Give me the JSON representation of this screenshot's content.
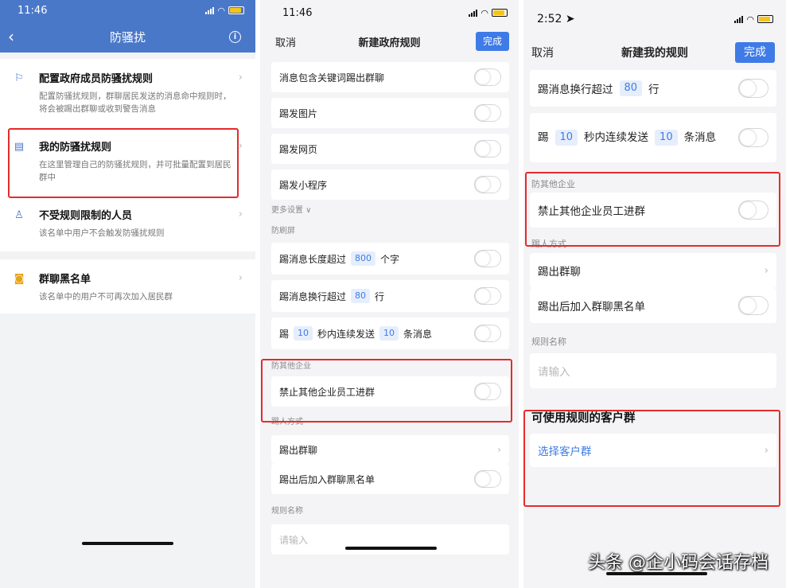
{
  "panel1": {
    "status_time": "11:46",
    "title": "防骚扰",
    "items": [
      {
        "title": "配置政府成员防骚扰规则",
        "desc": "配置防骚扰规则，群聊居民发送的消息命中规则时，将会被踢出群聊或收到警告消息"
      },
      {
        "title": "我的防骚扰规则",
        "desc": "在这里管理自己的防骚扰规则，并可批量配置到居民群中"
      },
      {
        "title": "不受规则限制的人员",
        "desc": "该名单中用户不会触发防骚扰规则"
      },
      {
        "title": "群聊黑名单",
        "desc": "该名单中的用户不可再次加入居民群"
      }
    ]
  },
  "panel2": {
    "status_time": "11:46",
    "cancel": "取消",
    "title": "新建政府规则",
    "done": "完成",
    "rows_top": [
      "消息包含关键词踢出群聊",
      "踢发图片",
      "踢发网页",
      "踢发小程序"
    ],
    "more_settings": "更多设置 ∨",
    "section_antiflood": "防刷屏",
    "len_prefix": "踢消息长度超过",
    "len_value": "800",
    "len_suffix": "个字",
    "lines_prefix": "踢消息换行超过",
    "lines_value": "80",
    "lines_suffix": "行",
    "burst_prefix": "踢",
    "burst_seconds": "10",
    "burst_mid": "秒内连续发送",
    "burst_count": "10",
    "burst_suffix": "条消息",
    "section_other": "防其他企业",
    "block_other": "禁止其他企业员工进群",
    "section_kick": "踢人方式",
    "kick_out": "踢出群聊",
    "kick_blacklist": "踢出后加入群聊黑名单",
    "section_name": "规则名称",
    "name_placeholder": "请输入"
  },
  "panel3": {
    "status_time": "2:52 ➤",
    "cancel": "取消",
    "title": "新建我的规则",
    "done": "完成",
    "lines_prefix": "踢消息换行超过",
    "lines_value": "80",
    "lines_suffix": "行",
    "burst_prefix": "踢",
    "burst_seconds": "10",
    "burst_mid": "秒内连续发送",
    "burst_count": "10",
    "burst_suffix": "条消息",
    "section_other": "防其他企业",
    "block_other": "禁止其他企业员工进群",
    "section_kick": "踢人方式",
    "kick_out": "踢出群聊",
    "kick_blacklist": "踢出后加入群聊黑名单",
    "section_name": "规则名称",
    "name_placeholder": "请输入",
    "groups_title": "可使用规则的客户群",
    "select_groups": "选择客户群"
  },
  "watermark": "头条 @企小码会话存档",
  "colors": {
    "nav_blue": "#4a78c9",
    "accent": "#3f7be6",
    "highlight_red": "#e52b2b"
  }
}
